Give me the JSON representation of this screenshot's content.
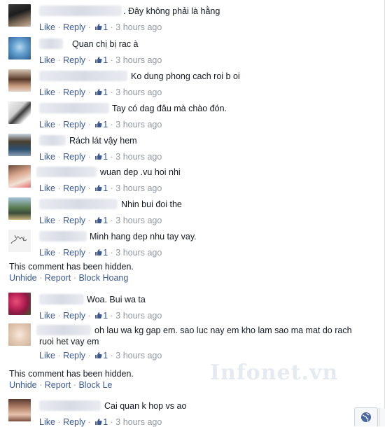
{
  "comments": [
    {
      "text": ". Đây không phải là hằng",
      "like": "Like",
      "reply": "Reply",
      "likes": "1",
      "time": "3 hours ago"
    },
    {
      "text": "Quan chị bị rac à",
      "like": "Like",
      "reply": "Reply",
      "likes": "1",
      "time": "3 hours ago"
    },
    {
      "text": "Ko dung phong cach roi b oi",
      "like": "Like",
      "reply": "Reply",
      "likes": "1",
      "time": "3 hours ago"
    },
    {
      "text": "Tay có dag đâu mà chào đón.",
      "like": "Like",
      "reply": "Reply",
      "likes": "1",
      "time": "3 hours ago"
    },
    {
      "text": "Rách lát vậy hem",
      "like": "Like",
      "reply": "Reply",
      "likes": "1",
      "time": "3 hours ago"
    },
    {
      "text": "wuan dep .vu hoi nhi",
      "like": "Like",
      "reply": "Reply",
      "likes": "1",
      "time": "3 hours ago"
    },
    {
      "text": "Nhin bui đoi the",
      "like": "Like",
      "reply": "Reply",
      "likes": "1",
      "time": "3 hours ago"
    },
    {
      "text": "Minh hang dep nhu tay vay.",
      "like": "Like",
      "reply": "Reply",
      "likes": "1",
      "time": "3 hours ago"
    },
    {
      "text": "Woa. Bui wa ta",
      "like": "Like",
      "reply": "Reply",
      "likes": "1",
      "time": "3 hours ago"
    },
    {
      "text_line1": "oh lau wa kg gap em. sao luc nay em kho lam sao ma mat do rach",
      "text_line2": "ruoi het vay em",
      "like": "Like",
      "reply": "Reply",
      "likes": "1",
      "time": "3 hours ago"
    },
    {
      "text": "Cai quan k hop vs ao",
      "like": "Like",
      "reply": "Reply",
      "likes": "1",
      "time": "3 hours ago"
    }
  ],
  "hidden": [
    {
      "message": "This comment has been hidden.",
      "unhide": "Unhide",
      "report": "Report",
      "block": "Block Hoang"
    },
    {
      "message": "This comment has been hidden.",
      "unhide": "Unhide",
      "report": "Report",
      "block": "Block Le"
    }
  ],
  "watermark": "Infonet.vn",
  "separator": "·",
  "colors": {
    "link": "#3b5998",
    "meta": "#9197a3",
    "text": "#141823"
  },
  "icons": {
    "like_count": "thumbs-up-icon",
    "chat": "globe-icon"
  }
}
